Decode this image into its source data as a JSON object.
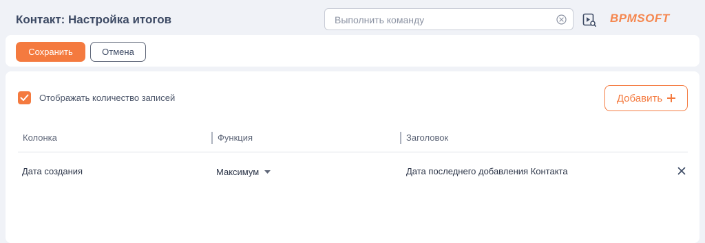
{
  "header": {
    "title": "Контакт: Настройка итогов",
    "command_placeholder": "Выполнить команду",
    "command_value": "",
    "logo": "BPMSOFT"
  },
  "toolbar": {
    "save_label": "Сохранить",
    "cancel_label": "Отмена"
  },
  "settings": {
    "show_count_label": "Отображать количество записей",
    "show_count_checked": true,
    "add_label": "Добавить"
  },
  "table": {
    "columns": [
      "Колонка",
      "Функция",
      "Заголовок"
    ],
    "rows": [
      {
        "column": "Дата создания",
        "function": "Максимум",
        "caption": "Дата последнего добавления Контакта"
      }
    ]
  },
  "icons": {
    "clear": "clear-circle-icon",
    "video": "video-help-icon",
    "checkbox": "checkmark-icon",
    "add": "plus-icon",
    "dropdown": "caret-down-icon",
    "remove": "close-icon"
  },
  "colors": {
    "accent": "#f47a3f",
    "background": "#f0f2f7",
    "text": "#2b3447"
  }
}
